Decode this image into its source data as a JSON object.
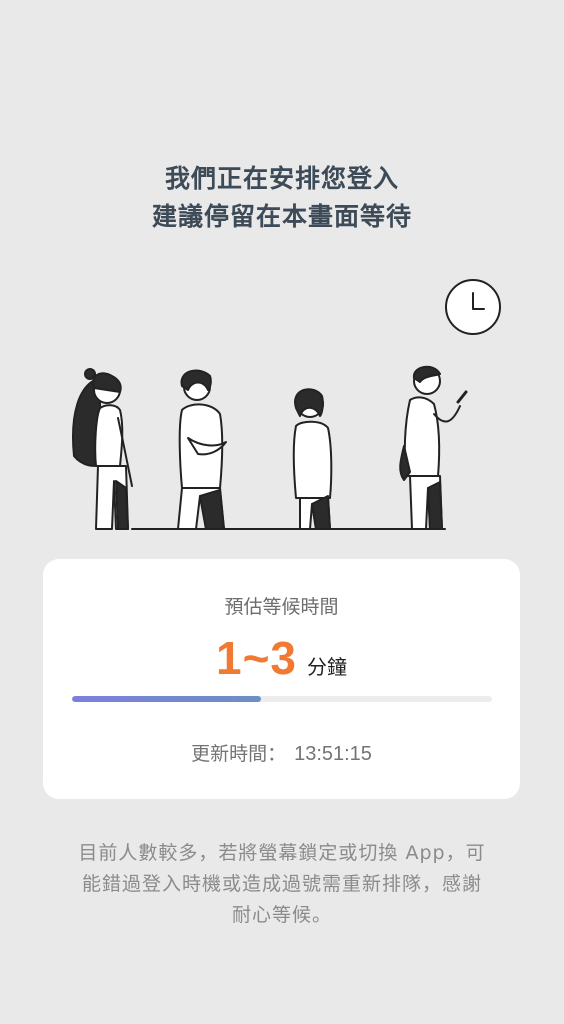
{
  "headline": {
    "line1": "我們正在安排您登入",
    "line2": "建議停留在本畫面等待"
  },
  "illustration": {
    "clock_icon": "clock-icon",
    "people_icon": "people-queue-illustration"
  },
  "wait_card": {
    "label": "預估等候時間",
    "eta_value": "1~3",
    "eta_unit": "分鐘",
    "progress_fraction": 0.45,
    "updated_label": "更新時間：",
    "updated_time": "13:51:15"
  },
  "notice": {
    "line1": "目前人數較多，若將螢幕鎖定或切換 App，可",
    "line2": "能錯過登入時機或造成過號需重新排隊，感謝",
    "line3": "耐心等候。"
  },
  "colors": {
    "background": "#e9e9e9",
    "accent_orange": "#f07a34",
    "progress_fill": "#7b80dc",
    "headline_text": "#3d4a57"
  }
}
